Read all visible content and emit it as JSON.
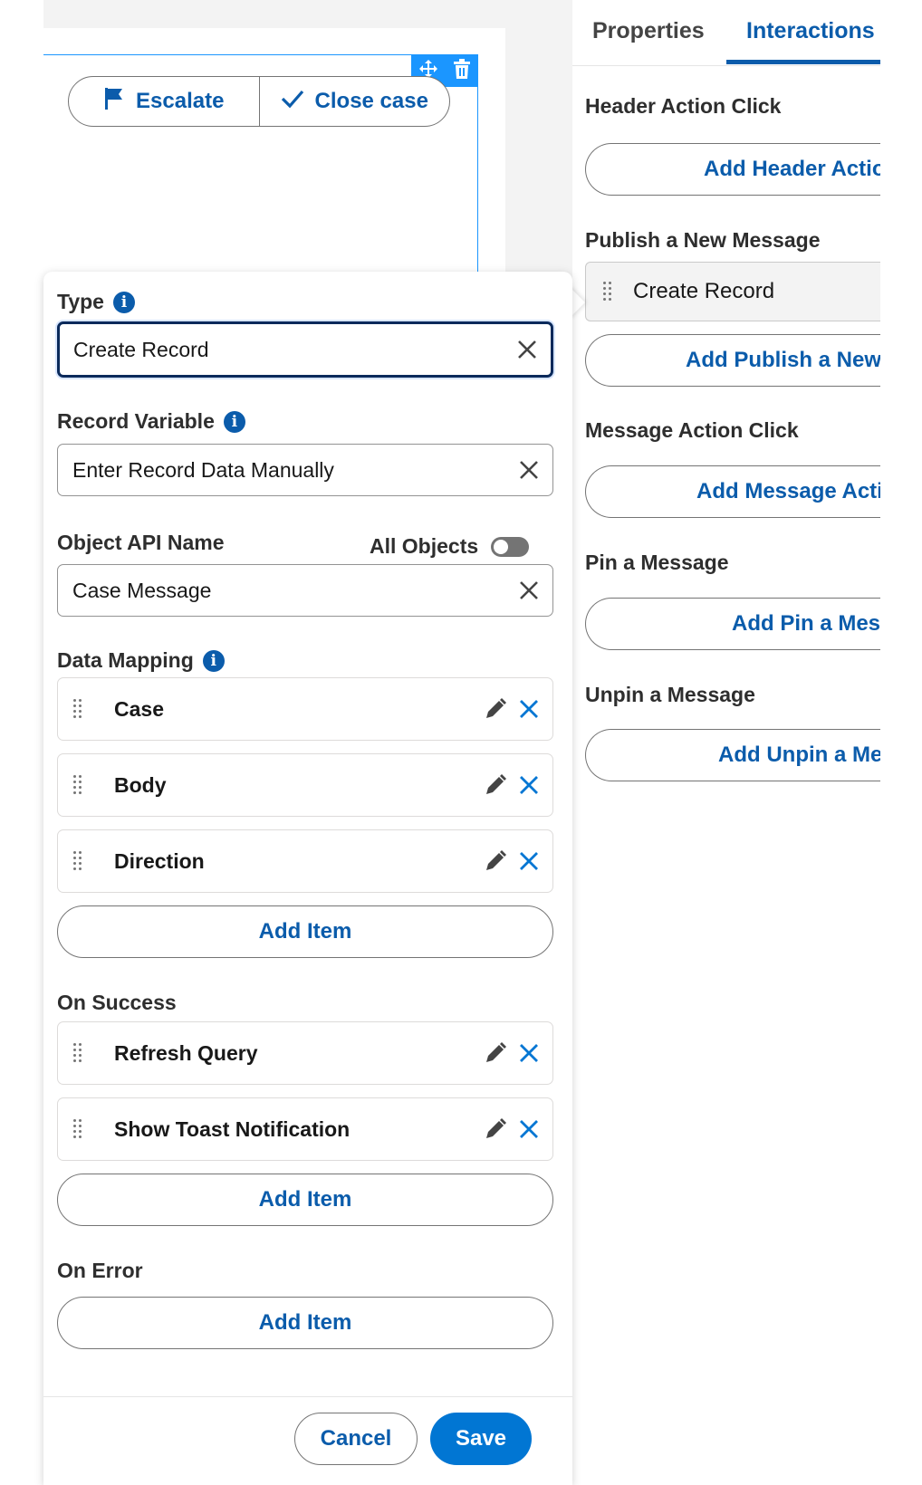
{
  "canvas": {
    "buttons": [
      {
        "label": "Escalate",
        "icon": "flag-icon"
      },
      {
        "label": "Close case",
        "icon": "check-icon"
      }
    ],
    "tools": [
      "move-icon",
      "delete-icon"
    ]
  },
  "panel": {
    "tabs": [
      {
        "label": "Properties",
        "active": false
      },
      {
        "label": "Interactions",
        "active": true
      }
    ],
    "sections": [
      {
        "title": "Header Action Click",
        "add_label": "Add Header Action Click"
      },
      {
        "title": "Publish a New Message",
        "item": "Create Record",
        "add_label": "Add Publish a New Message"
      },
      {
        "title": "Message Action Click",
        "add_label": "Add Message Action Click"
      },
      {
        "title": "Pin a Message",
        "add_label": "Add Pin a Message"
      },
      {
        "title": "Unpin a Message",
        "add_label": "Add Unpin a Message"
      }
    ]
  },
  "popover": {
    "type": {
      "label": "Type",
      "value": "Create Record"
    },
    "record_variable": {
      "label": "Record Variable",
      "value": "Enter Record Data Manually"
    },
    "object_api_name": {
      "label": "Object API Name",
      "toggle_label": "All Objects",
      "toggle_on": false,
      "value": "Case Message"
    },
    "data_mapping": {
      "label": "Data Mapping",
      "items": [
        "Case",
        "Body",
        "Direction"
      ],
      "add_label": "Add Item"
    },
    "on_success": {
      "label": "On Success",
      "items": [
        "Refresh Query",
        "Show Toast Notification"
      ],
      "add_label": "Add Item"
    },
    "on_error": {
      "label": "On Error",
      "add_label": "Add Item"
    },
    "footer": {
      "cancel": "Cancel",
      "save": "Save"
    }
  },
  "colors": {
    "brand": "#0176d3",
    "link": "#0b5cab",
    "selection": "#1b96ff"
  }
}
